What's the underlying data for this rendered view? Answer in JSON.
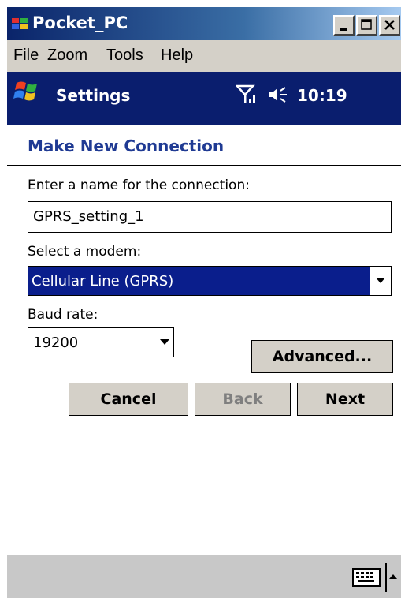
{
  "window": {
    "title": "Pocket_PC",
    "menu": [
      "File",
      "Zoom",
      "Tools",
      "Help"
    ]
  },
  "nav": {
    "title": "Settings",
    "time": "10:19",
    "icons": [
      "windows-start-icon",
      "signal-icon",
      "volume-icon"
    ]
  },
  "page": {
    "title": "Make New Connection",
    "name_label": "Enter a name for the connection:",
    "name_value": "GPRS_setting_1",
    "modem_label": "Select a modem:",
    "modem_value": "Cellular Line (GPRS)",
    "baud_label": "Baud rate:",
    "baud_value": "19200",
    "advanced_label": "Advanced...",
    "cancel_label": "Cancel",
    "back_label": "Back",
    "next_label": "Next"
  },
  "colors": {
    "nav_bg": "#0a1e6e",
    "title_color": "#1f3a93",
    "selected_bg": "#0a1e8c",
    "button_face": "#d4d0c8"
  }
}
